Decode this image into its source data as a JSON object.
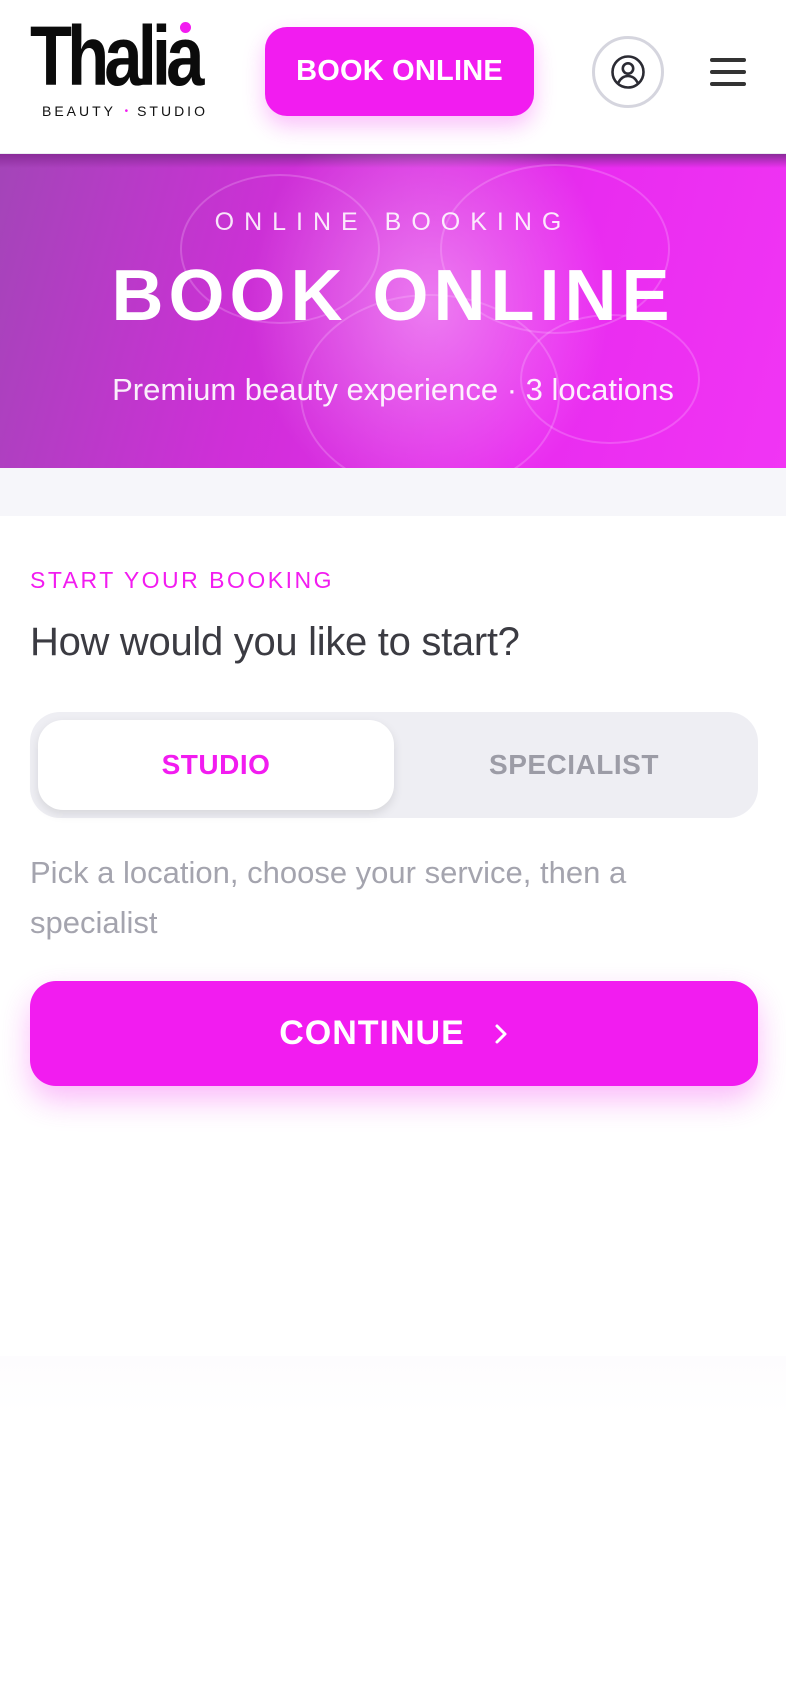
{
  "header": {
    "logo_word": "Thalia",
    "logo_tag_left": "BEAUTY",
    "logo_tag_sep": "•",
    "logo_tag_right": "STUDIO",
    "book_button_label": "BOOK ONLINE",
    "account_icon": "user-circle-icon",
    "menu_icon": "hamburger-menu-icon"
  },
  "hero": {
    "eyebrow": "ONLINE BOOKING",
    "title": "BOOK ONLINE",
    "subtitle": "Premium beauty experience · 3 locations"
  },
  "booking": {
    "section_label": "START YOUR BOOKING",
    "question": "How would you like to start?",
    "options": [
      {
        "label": "STUDIO",
        "selected": true
      },
      {
        "label": "SPECIALIST",
        "selected": false
      }
    ],
    "helper_text": "Pick a location, choose your service, then a specialist",
    "continue_label": "CONTINUE",
    "continue_icon": "chevron-right-icon"
  },
  "colors": {
    "accent": "#f21cf0",
    "text_dark": "#3b3b42",
    "text_muted": "#a4a4ae",
    "segment_bg": "#eeeef3"
  }
}
